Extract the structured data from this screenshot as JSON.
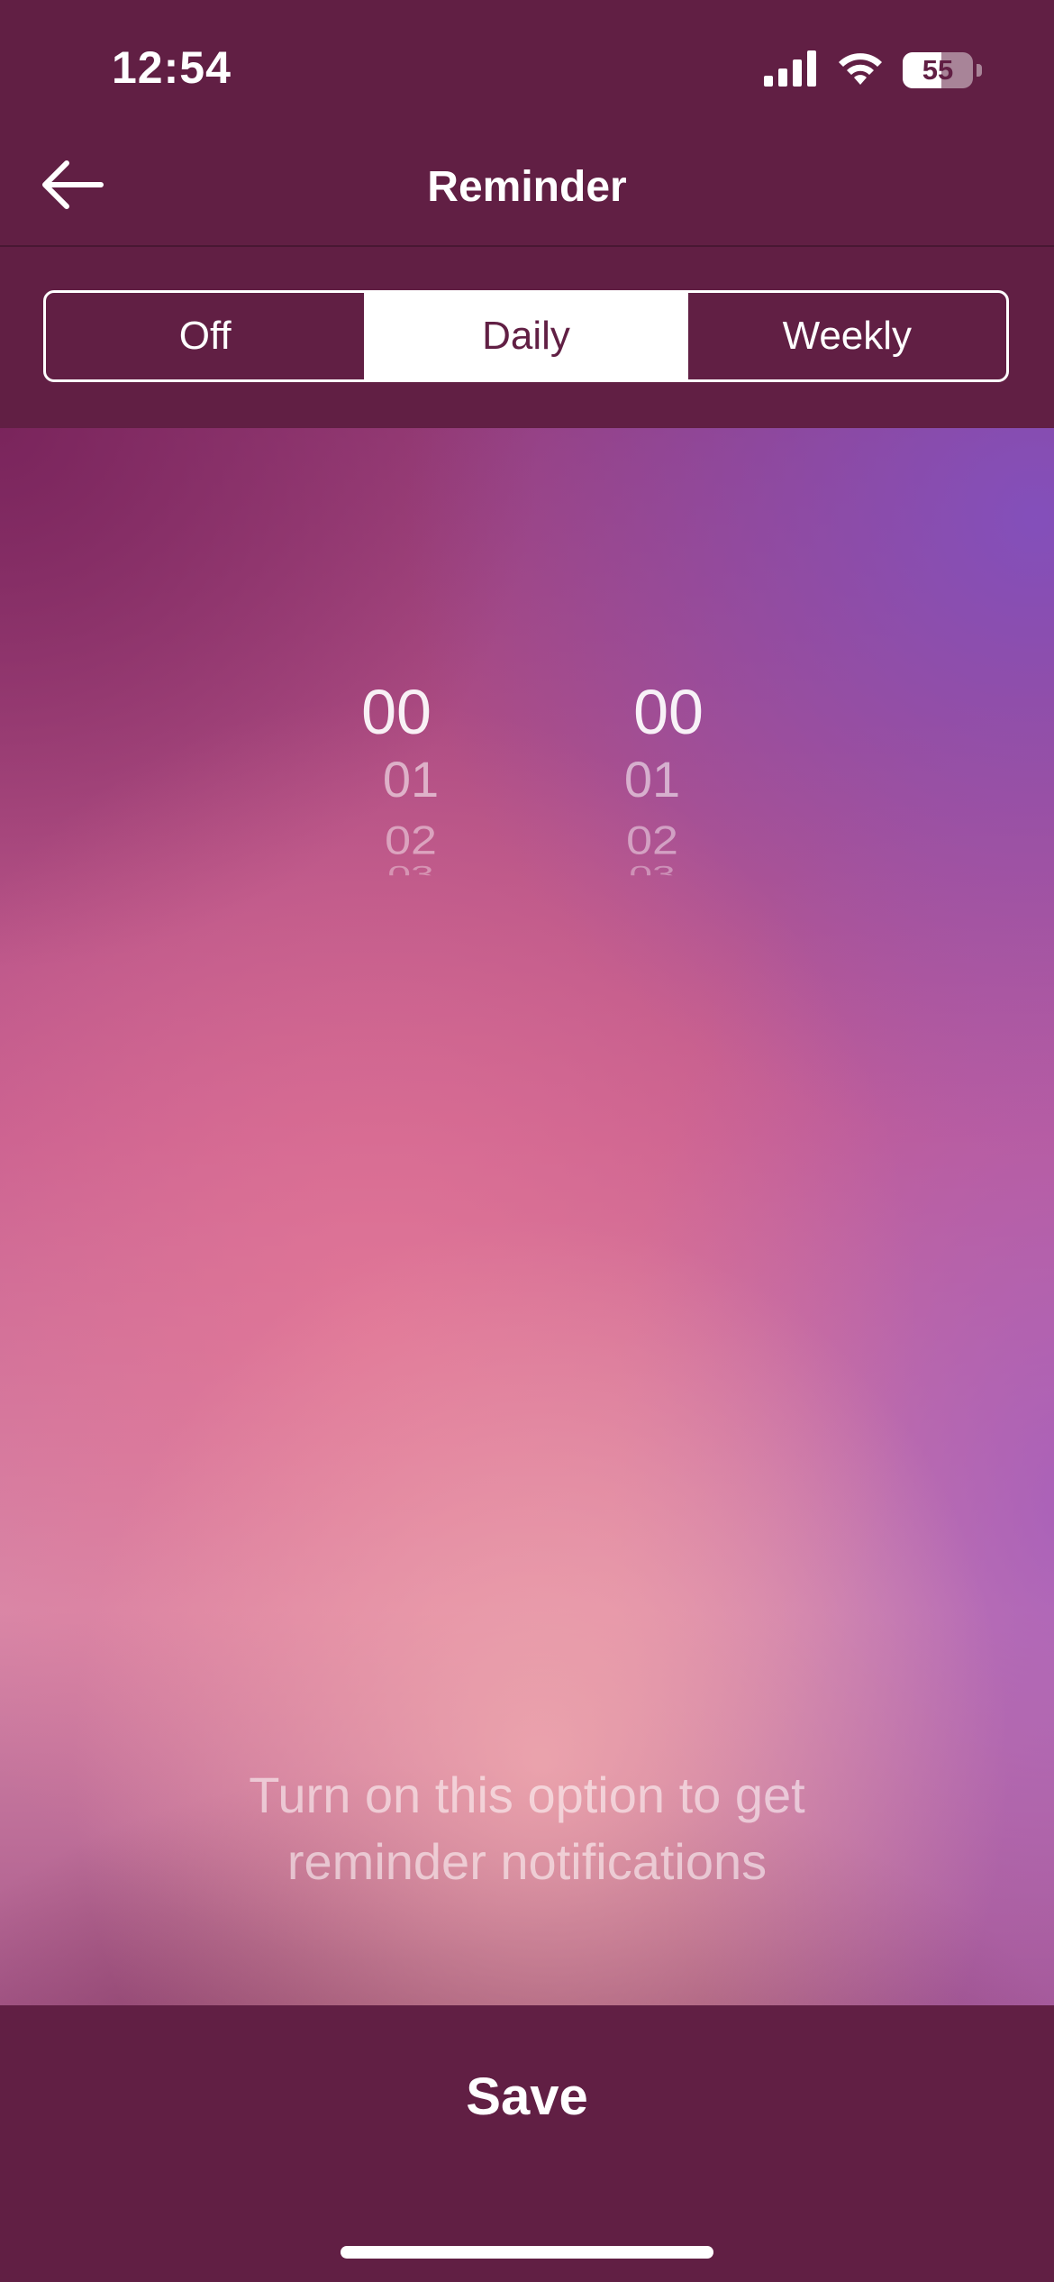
{
  "status_bar": {
    "time": "12:54",
    "battery_level": "55",
    "battery_fraction": 0.55,
    "icons": [
      "cellular-signal-icon",
      "wifi-icon",
      "battery-icon"
    ]
  },
  "nav": {
    "title": "Reminder",
    "back_icon": "arrow-left-icon"
  },
  "segments": {
    "items": [
      {
        "label": "Off",
        "selected": false
      },
      {
        "label": "Daily",
        "selected": true
      },
      {
        "label": "Weekly",
        "selected": false
      }
    ]
  },
  "picker": {
    "hours": {
      "selected": "00",
      "next": [
        "01",
        "02",
        "03"
      ]
    },
    "minutes": {
      "selected": "00",
      "next": [
        "01",
        "02",
        "03"
      ]
    }
  },
  "hint": {
    "line1": "Turn on this option to get",
    "line2": "reminder notifications"
  },
  "footer": {
    "save_label": "Save"
  },
  "colors": {
    "primary": "#611f44",
    "text_on_primary": "#ffffff"
  }
}
